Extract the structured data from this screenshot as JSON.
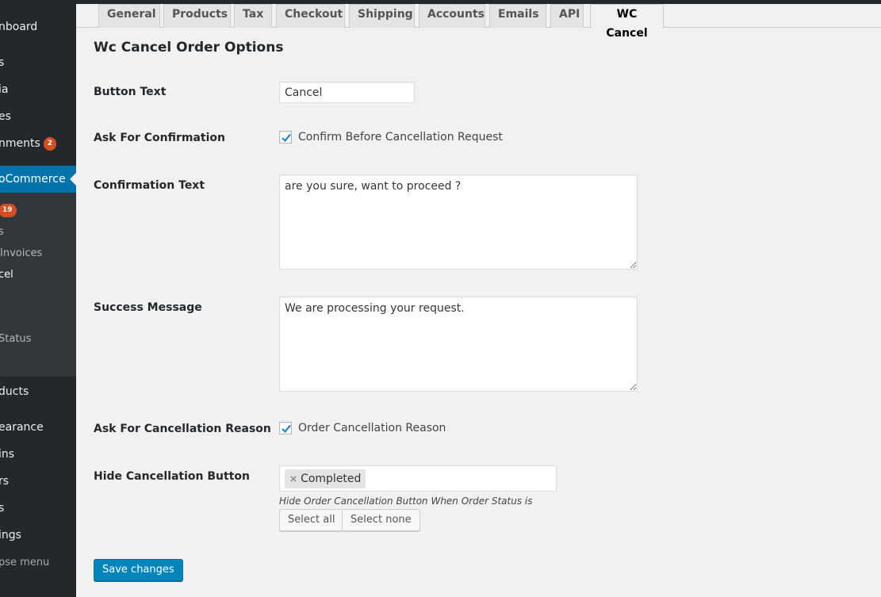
{
  "sidebar": {
    "items": [
      {
        "label": "nboard"
      },
      {
        "label": "s"
      },
      {
        "label": "ia"
      },
      {
        "label": "es"
      },
      {
        "label": "nments",
        "badge": "2"
      },
      {
        "label": "oCommerce"
      },
      {
        "label": "",
        "badge": "19"
      },
      {
        "label": "s"
      },
      {
        "label": "Invoices"
      },
      {
        "label": "cel"
      },
      {
        "label": "Status"
      },
      {
        "label": "ducts"
      },
      {
        "label": "earance"
      },
      {
        "label": "ins"
      },
      {
        "label": "rs"
      },
      {
        "label": "s"
      },
      {
        "label": "ings"
      },
      {
        "label": "pse menu"
      }
    ]
  },
  "tabs": [
    {
      "label": "General"
    },
    {
      "label": "Products"
    },
    {
      "label": "Tax"
    },
    {
      "label": "Checkout"
    },
    {
      "label": "Shipping"
    },
    {
      "label": "Accounts"
    },
    {
      "label": "Emails"
    },
    {
      "label": "API"
    },
    {
      "label": "WC Cancel",
      "active": true
    }
  ],
  "form": {
    "title": "Wc Cancel Order Options",
    "button_text": {
      "label": "Button Text",
      "value": "Cancel"
    },
    "ask_confirmation": {
      "label": "Ask For Confirmation",
      "checkbox_label": "Confirm Before Cancellation Request",
      "checked": true
    },
    "confirmation_text": {
      "label": "Confirmation Text",
      "value": "are you sure, want to proceed ?"
    },
    "success_message": {
      "label": "Success Message",
      "value": "We are processing your request."
    },
    "ask_reason": {
      "label": "Ask For Cancellation Reason",
      "checkbox_label": "Order Cancellation Reason",
      "checked": true
    },
    "hide_button": {
      "label": "Hide Cancellation Button",
      "selected": [
        "Completed"
      ],
      "chip_remove": "×",
      "description": "Hide Order Cancellation Button When Order Status is",
      "select_all": "Select all",
      "select_none": "Select none"
    },
    "save_label": "Save changes"
  },
  "colors": {
    "sidebar_bg": "#23282d",
    "active_menu": "#0073aa",
    "badge": "#d54e21",
    "primary_button": "#0085ba",
    "checkmark": "#1e8cbe"
  }
}
